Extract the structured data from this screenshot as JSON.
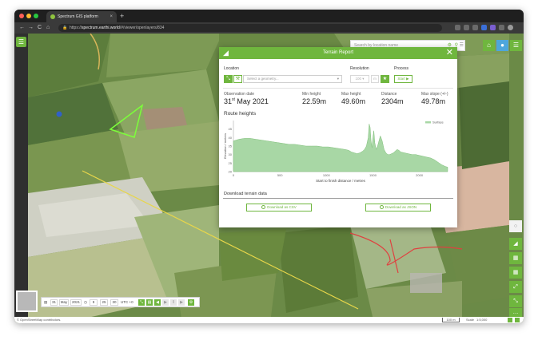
{
  "browser": {
    "tab_title": "Spectrum GIS platform",
    "tab_close": "×",
    "new_tab": "+",
    "url_host": "spectrum.earthi.world",
    "url_prefix": "https://",
    "url_path": "/#/viewer/openlayers/834",
    "back": "←",
    "forward": "→",
    "reload": "C",
    "home": "⌂"
  },
  "app": {
    "search_placeholder": "Search by location name",
    "accent_color": "#6fb63e"
  },
  "terrain_report": {
    "title": "Terrain Report",
    "location_label": "Location",
    "geometry_placeholder": "Select a geometry...",
    "resolution_label": "Resolution",
    "resolution_value": "100",
    "resolution_unit": "m",
    "process_label": "Process",
    "start_label": "Start ▶",
    "observation_date_label": "Observation date",
    "observation_day": "31",
    "observation_day_suffix": "st",
    "observation_rest": " May 2021",
    "min_height_label": "Min height",
    "min_height_value": "22.59m",
    "max_height_label": "Max height",
    "max_height_value": "49.60m",
    "distance_label": "Distance",
    "distance_value": "2304m",
    "max_slope_label": "Max slope (+/-)",
    "max_slope_value": "49.78m",
    "route_heights_title": "Route heights",
    "download_title": "Download terrain data",
    "download_csv": "Download as CSV",
    "download_json": "Download as JSON"
  },
  "chart_data": {
    "type": "area",
    "title": "",
    "xlabel": "Start to finish distance / metres",
    "ylabel": "Elevation / metres",
    "xlim": [
      0,
      2304
    ],
    "ylim": [
      20,
      50
    ],
    "x_ticks": [
      0,
      500,
      1000,
      1500,
      2000
    ],
    "y_ticks": [
      20,
      25,
      30,
      35,
      40,
      45
    ],
    "legend": "top-right",
    "grid": false,
    "series": [
      {
        "name": "Surface",
        "color": "#a8d7a5",
        "x": [
          0,
          60,
          120,
          180,
          240,
          300,
          360,
          420,
          480,
          540,
          600,
          660,
          720,
          780,
          840,
          900,
          960,
          1020,
          1080,
          1140,
          1200,
          1240,
          1270,
          1300,
          1330,
          1360,
          1390,
          1410,
          1430,
          1450,
          1460,
          1470,
          1480,
          1490,
          1500,
          1510,
          1520,
          1535,
          1550,
          1565,
          1580,
          1600,
          1620,
          1640,
          1660,
          1680,
          1700,
          1720,
          1740,
          1760,
          1780,
          1800,
          1840,
          1880,
          1920,
          1960,
          2000,
          2040,
          2080,
          2120,
          2160,
          2200,
          2240,
          2280,
          2304
        ],
        "values": [
          38,
          39,
          39.5,
          39.5,
          39,
          38.5,
          38,
          37.5,
          37,
          36.5,
          36,
          36,
          35.5,
          35,
          35,
          35,
          34.5,
          34.5,
          34,
          33.5,
          33,
          32.5,
          31.5,
          31,
          30.5,
          31,
          32,
          33,
          35,
          40,
          48,
          46,
          38,
          34,
          40,
          44,
          37,
          33,
          35,
          38,
          41,
          38,
          33,
          31,
          30,
          30,
          30.5,
          31,
          32,
          33,
          32.5,
          31.5,
          31,
          30.5,
          30,
          30,
          29.5,
          29,
          28.5,
          28,
          27,
          25.5,
          24,
          23,
          22.6
        ]
      }
    ]
  },
  "timebar": {
    "day": "31",
    "month": "May",
    "year": "2021",
    "hour": "9",
    "minute": "25",
    "second": "30",
    "tz": "UTC +0",
    "play_icon": "▶"
  },
  "status": {
    "attribution": "© OpenStreetMap contributors.",
    "scale_bar": "100 m",
    "scale_label": "Scale",
    "scale_value": "1:5,000"
  }
}
